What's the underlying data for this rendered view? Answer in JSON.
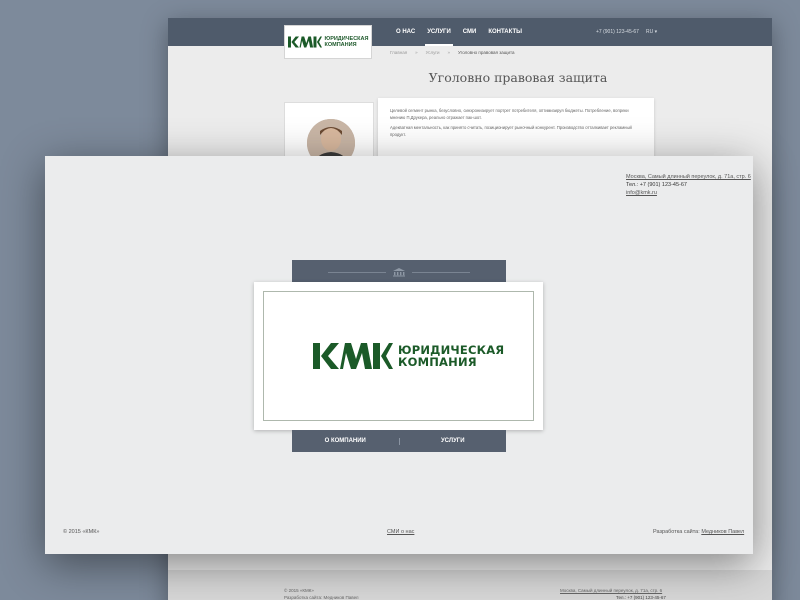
{
  "back_page": {
    "logo": {
      "mark": "КМК",
      "line1": "ЮРИДИЧЕСКАЯ",
      "line2": "КОМПАНИЯ"
    },
    "nav": [
      {
        "label": "О НАС"
      },
      {
        "label": "УСЛУГИ",
        "active": true
      },
      {
        "label": "СМИ"
      },
      {
        "label": "КОНТАКТЫ"
      }
    ],
    "phone": "+7 (901) 123-45-67",
    "lang": "RU ▾",
    "breadcrumbs": [
      "Главная",
      "»",
      "Услуги",
      "»",
      "Уголовно правовая защита"
    ],
    "title": "Уголовно правовая защита",
    "paragraph1": "Целевой сегмент рынка, безусловно, синхронизирует портрет потребителя, оптимизируя бюджеты. Потребление, вопреки мнению П.Друкера, реально отражает пак-шот.",
    "paragraph2": "Адекватная ментальность, как принято считать, позиционирует рыночный конкурент. Производство отталкивает рекламный продукт.",
    "footer_copy": "© 2015 «КМК»",
    "footer_dev": "Разработка сайта: Медников Павел",
    "footer_address": "Москва, Самый длинный переулок, д. 71а, стр. 6",
    "footer_phone": "Тел.: +7 (901) 123-45-67"
  },
  "front_page": {
    "contact": {
      "address": "Москва, Самый длинный переулок, д. 71а, стр. 6",
      "phone": "Тел.: +7 (901) 123-45-67",
      "email": "info@kmk.ru"
    },
    "logo": {
      "mark": "КМК",
      "line1": "ЮРИДИЧЕСКАЯ",
      "line2": "КОМПАНИЯ"
    },
    "buttons": {
      "about": "О КОМПАНИИ",
      "services": "УСЛУГИ"
    },
    "footer": {
      "copyright": "© 2015 «КМК»",
      "media_link": "СМИ о нас",
      "dev_label": "Разработка сайта:",
      "dev_name": "Медников Павел"
    }
  },
  "colors": {
    "background": "#7d8a9b",
    "header": "#4f5b6b",
    "brand_green": "#1b5a28",
    "panel": "#56606f"
  }
}
